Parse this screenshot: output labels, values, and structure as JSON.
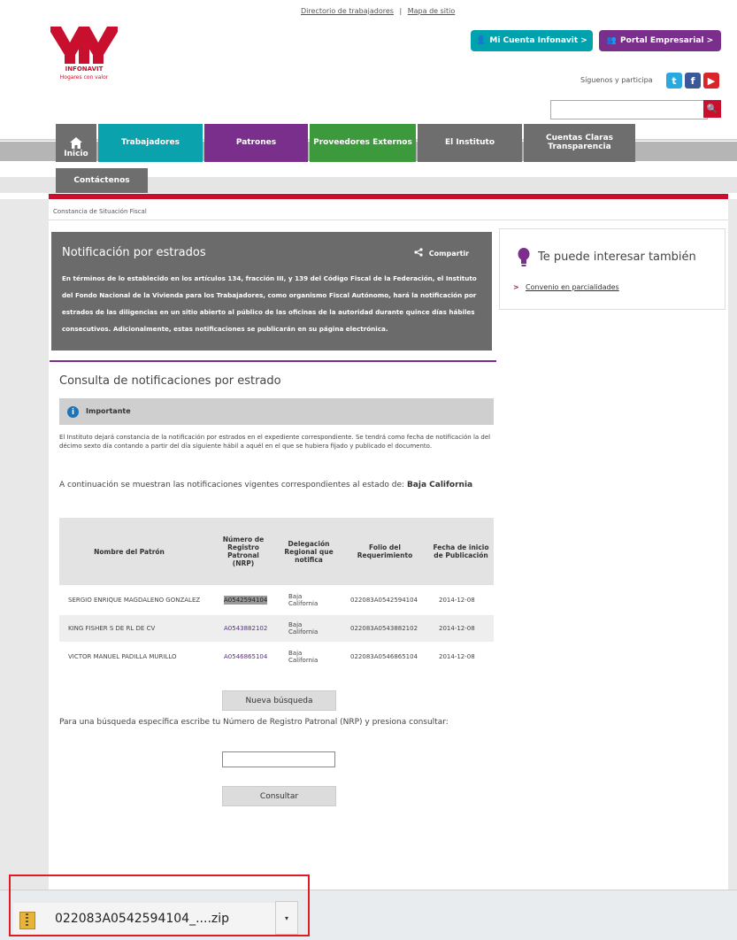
{
  "top_links": {
    "directorio": "Directorio de trabajadores",
    "separator": "|",
    "mapa": "Mapa de sitio"
  },
  "logo": {
    "name": "INFONAVIT",
    "tagline": "Hogares con valor"
  },
  "header_buttons": {
    "mi_cuenta": "Mi Cuenta Infonavit >",
    "portal": "Portal Empresarial >"
  },
  "social": {
    "label": "Síguenos y participa",
    "twitter": "t",
    "facebook": "f",
    "youtube": "▶"
  },
  "search": {
    "placeholder": "",
    "button": "🔍"
  },
  "nav": {
    "inicio": "Inicio",
    "trabajadores": "Trabajadores",
    "patrones": "Patrones",
    "proveedores": "Proveedores Externos",
    "instituto": "El Instituto",
    "cuentas": "Cuentas Claras Transparencia",
    "contactenos": "Contáctenos"
  },
  "breadcrumb": "Constancia de Situación Fiscal",
  "notification": {
    "title": "Notificación por estrados",
    "share": "Compartir",
    "body": "En términos de lo establecido en los artículos 134, fracción III, y 139 del Código Fiscal de la Federación, el Instituto del Fondo Nacional de la Vivienda para los Trabajadores, como organismo Fiscal Autónomo, hará la notificación por estrados de las diligencias en un sitio abierto al público de las oficinas de la autoridad durante quince días hábiles consecutivos. Adicionalmente, estas notificaciones se publicarán en su página electrónica."
  },
  "sidebar": {
    "title": "Te puede interesar también",
    "link": "Convenio en parcialidades"
  },
  "consulta": {
    "title": "Consulta de notificaciones por estrado",
    "important_label": "Importante",
    "important_text": "El Instituto dejará constancia de la notificación por estrados en el expediente correspondiente. Se tendrá como fecha de notificación la del décimo sexto día contando a partir del día siguiente hábil a aquél en el que se hubiera fijado y publicado el documento.",
    "intro": "A continuación se muestran las notificaciones vigentes correspondientes al estado de:",
    "estado": "Baja California"
  },
  "table": {
    "headers": [
      "Nombre del Patrón",
      "Número de Registro Patronal (NRP)",
      "Delegación Regional que notifica",
      "Folio del Requerimiento",
      "Fecha de inicio de Publicación"
    ],
    "rows": [
      {
        "nombre": "SERGIO ENRIQUE MAGDALENO GONZALEZ",
        "nrp": "A0542594104",
        "delegacion": "Baja California",
        "folio": "022083A0542594104",
        "fecha": "2014-12-08"
      },
      {
        "nombre": "KING FISHER S DE RL DE CV",
        "nrp": "A0543882102",
        "delegacion": "Baja California",
        "folio": "022083A0543882102",
        "fecha": "2014-12-08"
      },
      {
        "nombre": "VICTOR MANUEL PADILLA MURILLO",
        "nrp": "A0546865104",
        "delegacion": "Baja California",
        "folio": "022083A0546865104",
        "fecha": "2014-12-08"
      }
    ]
  },
  "buttons": {
    "nueva": "Nueva búsqueda",
    "consultar": "Consultar"
  },
  "busqueda_text": "Para una búsqueda específica escribe tu Número de Registro Patronal (NRP) y presiona consultar:",
  "download": {
    "filename": "022083A0542594104_....zip",
    "menu": "▾"
  },
  "colors": {
    "red": "#c8102e",
    "teal": "#0aa2ad",
    "purple": "#7b2f8c",
    "green": "#3c9a3c",
    "gray": "#6e6e6e"
  }
}
